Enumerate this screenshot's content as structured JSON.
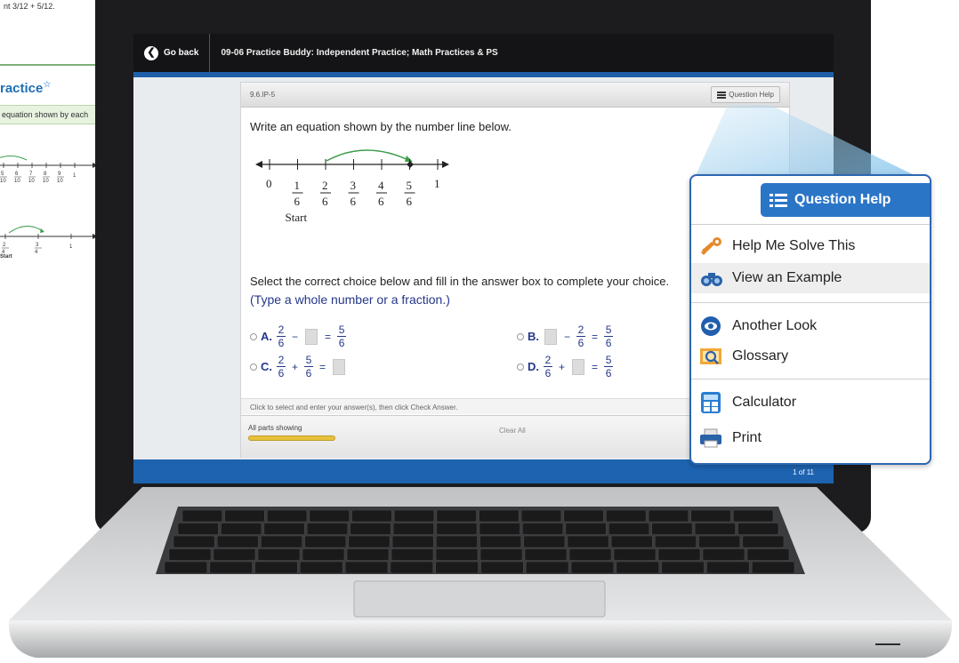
{
  "book": {
    "top_fraction_text": "nt 3/12 + 5/12.",
    "practice_title": "ractice",
    "practice_star": "☆",
    "instruction": "equation shown by each",
    "line1_labels": [
      "5/10",
      "6/10",
      "7/10",
      "8/10",
      "9/10",
      "1"
    ],
    "line2_labels": [
      "2/4",
      "3/4",
      "1"
    ],
    "line2_start": "Start"
  },
  "app": {
    "back_label": "Go back",
    "title": "09-06 Practice Buddy: Independent Practice; Math Practices & PS"
  },
  "question": {
    "id": "9.6.IP-5",
    "help_button": "Question Help",
    "prompt": "Write an equation shown by the number line below.",
    "number_line": {
      "zero_label": "0",
      "one_label": "1",
      "fractions": [
        "1/6",
        "2/6",
        "3/6",
        "4/6",
        "5/6"
      ],
      "start_label": "Start"
    },
    "select_prompt": "Select the correct choice below and fill in the answer box to complete your choice.",
    "type_hint": "(Type a whole number or a fraction.)",
    "choices": [
      {
        "letter": "A.",
        "id": "A"
      },
      {
        "letter": "B.",
        "id": "B"
      },
      {
        "letter": "C.",
        "id": "C"
      },
      {
        "letter": "D.",
        "id": "D"
      }
    ],
    "instruction_footer": "Click to select and enter your answer(s), then click Check Answer.",
    "parts_label": "All parts showing",
    "clear_all": "Clear All",
    "page_count": "1 of 11",
    "progress_fraction": 1.0
  },
  "question_help_popup": {
    "title": "Question Help",
    "items": [
      {
        "label": "Help Me Solve This",
        "icon": "key-icon"
      },
      {
        "label": "View an Example",
        "icon": "binoculars-icon",
        "highlighted": true
      },
      {
        "label": "Another Look",
        "icon": "eye-icon"
      },
      {
        "label": "Glossary",
        "icon": "glossary-icon"
      },
      {
        "label": "Calculator",
        "icon": "calculator-icon"
      },
      {
        "label": "Print",
        "icon": "printer-icon"
      }
    ]
  },
  "colors": {
    "header_blue": "#1f5ea8",
    "popup_blue": "#2b75c7",
    "choice_text": "#24378a",
    "progress": "#e8c13c"
  }
}
